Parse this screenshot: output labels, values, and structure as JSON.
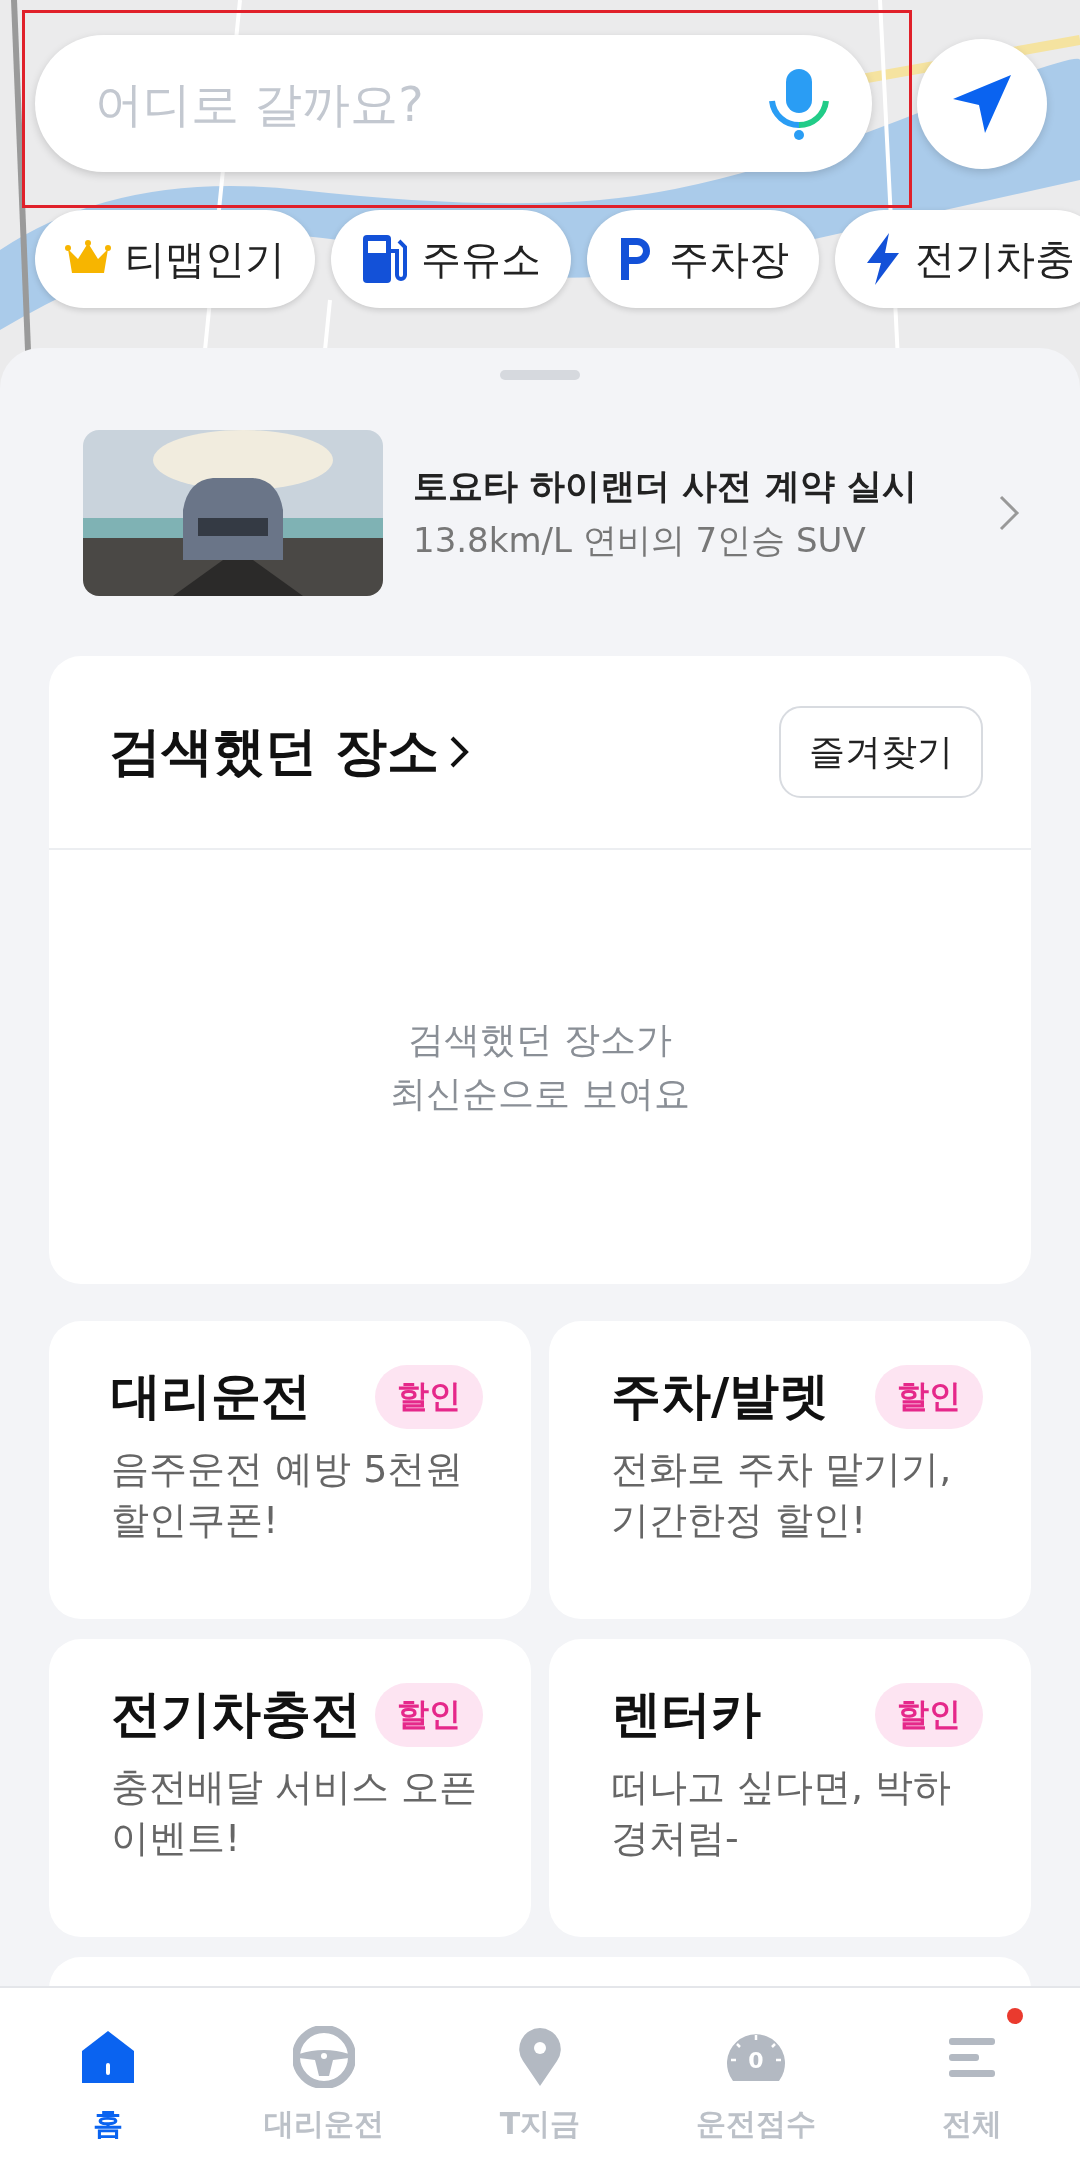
{
  "search": {
    "placeholder": "어디로 갈까요?",
    "highlighted": true
  },
  "chips": [
    {
      "kind": "crown",
      "label": "티맵인기"
    },
    {
      "kind": "fuel",
      "label": "주유소"
    },
    {
      "kind": "parking",
      "label": "주차장"
    },
    {
      "kind": "bolt",
      "label": "전기차충"
    }
  ],
  "banner": {
    "title": "토요타 하이랜더 사전 계약 실시",
    "subtitle": "13.8km/L 연비의 7인승 SUV"
  },
  "recent": {
    "title": "검색했던 장소",
    "favorites_button": "즐겨찾기",
    "empty_lines": [
      "검색했던 장소가",
      "최신순으로 보여요"
    ]
  },
  "services": [
    {
      "title": "대리운전",
      "badge": "할인",
      "description": "음주운전 예방 5천원 할인쿠폰!"
    },
    {
      "title": "주차/발렛",
      "badge": "할인",
      "description": "전화로 주차 맡기기, 기간한정 할인!"
    },
    {
      "title": "전기차충전",
      "badge": "할인",
      "description": "충전배달 서비스 오픈 이벤트!"
    },
    {
      "title": "렌터카",
      "badge": "할인",
      "description": "떠나고 싶다면, 박하 경처럼-"
    }
  ],
  "nav": [
    {
      "kind": "home",
      "label": "홈",
      "selected": true
    },
    {
      "kind": "wheel",
      "label": "대리운전",
      "selected": false
    },
    {
      "kind": "pin",
      "label": "T지금",
      "selected": false
    },
    {
      "kind": "gauge",
      "label": "운전점수",
      "selected": false,
      "value": "0"
    },
    {
      "kind": "menu",
      "label": "전체",
      "selected": false,
      "notification": true
    }
  ]
}
